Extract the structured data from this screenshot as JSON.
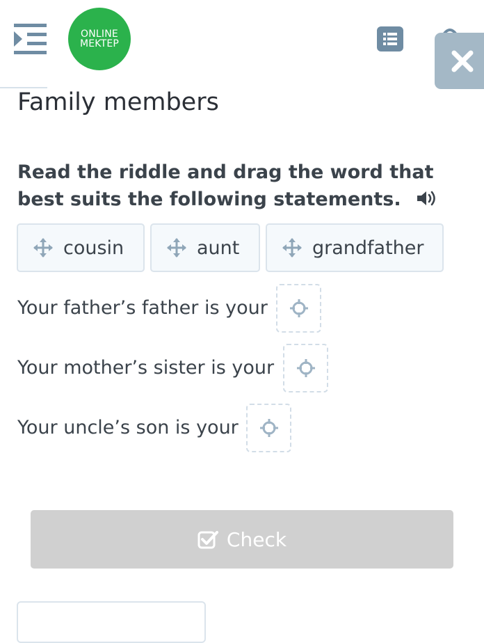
{
  "header": {
    "logo_line1": "ONLINE",
    "logo_line2": "MEKTEP",
    "menu_icon": "menu-indent-icon",
    "list_icon": "list-icon",
    "close_icon": "close-icon"
  },
  "page": {
    "title": "Family members",
    "instruction": "Read the riddle and drag the word that best suits the following statements."
  },
  "word_bank": [
    {
      "label": "cousin",
      "icon": "move-icon"
    },
    {
      "label": "aunt",
      "icon": "move-icon"
    },
    {
      "label": "grandfather",
      "icon": "move-icon"
    }
  ],
  "statements": [
    {
      "text": "Your father’s father is your"
    },
    {
      "text": "Your mother’s sister is your"
    },
    {
      "text": "Your uncle’s son is your"
    }
  ],
  "check_button": {
    "label": "Check",
    "icon": "checkbox-icon"
  },
  "colors": {
    "logo_green": "#2bb24c",
    "menu_blue": "#6f8ca3",
    "close_bg": "#a4b8c6",
    "check_disabled": "#d0d0d0",
    "chip_bg": "#f5f9fc"
  }
}
